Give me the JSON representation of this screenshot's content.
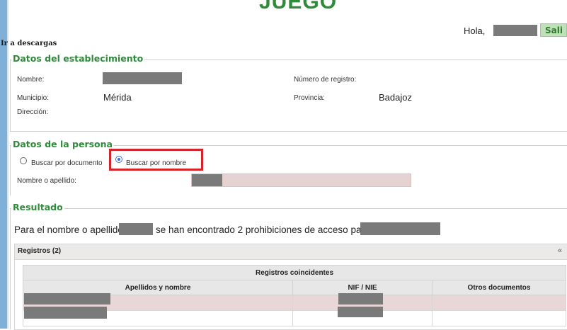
{
  "header": {
    "title": "JUEGO",
    "greeting": "Hola,",
    "exit_label": "Sali",
    "download_link": "Ir a descargas"
  },
  "establecimiento": {
    "legend": "Datos del establecimiento",
    "nombre_label": "Nombre:",
    "municipio_label": "Municipio:",
    "municipio_value": "Mérida",
    "direccion_label": "Dirección:",
    "registro_label": "Número de registro:",
    "provincia_label": "Provincia:",
    "provincia_value": "Badajoz"
  },
  "persona": {
    "legend": "Datos de la persona",
    "option_documento": "Buscar por documento",
    "option_nombre": "Buscar por nombre",
    "selected": "Buscar por nombre",
    "nombre_label": "Nombre o apellido:"
  },
  "resultado": {
    "legend": "Resultado",
    "text_part1": "Para el nombre o apellido",
    "text_part2": "se han encontrado 2 prohibiciones de acceso para",
    "panel_title": "Registros (2)",
    "collapse_icon": "«",
    "table": {
      "caption": "Registros coincidentes",
      "columns": [
        "Apellidos y nombre",
        "NIF / NIE",
        "Otros documentos"
      ]
    }
  },
  "colors": {
    "accent_green": "#2e8b3a",
    "highlight_red": "#d6232a",
    "row_pink": "#e9d6d6"
  }
}
